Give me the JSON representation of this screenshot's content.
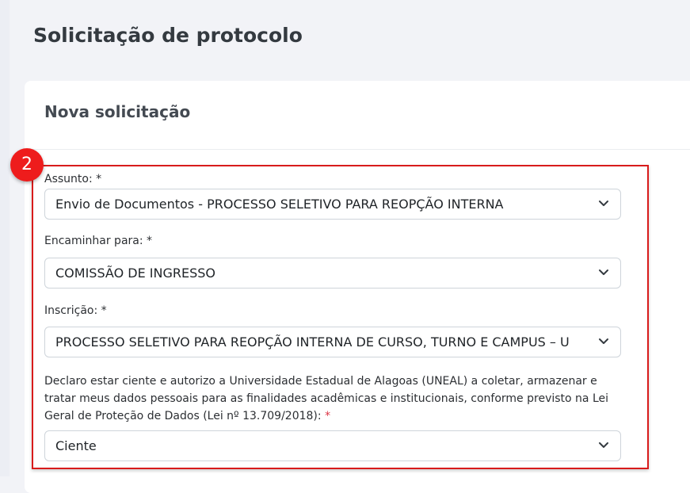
{
  "page": {
    "title": "Solicitação de protocolo"
  },
  "card": {
    "title": "Nova solicitação"
  },
  "step_badge": "2",
  "fields": {
    "assunto": {
      "label": "Assunto: *",
      "value": "Envio de Documentos - PROCESSO SELETIVO PARA REOPÇÃO INTERNA"
    },
    "encaminhar": {
      "label": "Encaminhar para: *",
      "value": "COMISSÃO DE INGRESSO"
    },
    "inscricao": {
      "label": "Inscrição: *",
      "value": "PROCESSO SELETIVO PARA REOPÇÃO INTERNA DE CURSO, TURNO E CAMPUS – U"
    },
    "consent": {
      "label": "Declaro estar ciente e autorizo a Universidade Estadual de Alagoas (UNEAL) a coletar, armazenar e tratar meus dados pessoais para as finalidades acadêmicas e institucionais, conforme previsto na Lei Geral de Proteção de Dados (Lei nº 13.709/2018):",
      "required_mark": "*",
      "value": "Ciente"
    }
  },
  "colors": {
    "highlight": "#d81b1b",
    "badge": "#ee1c1c",
    "required": "#dc3545"
  }
}
